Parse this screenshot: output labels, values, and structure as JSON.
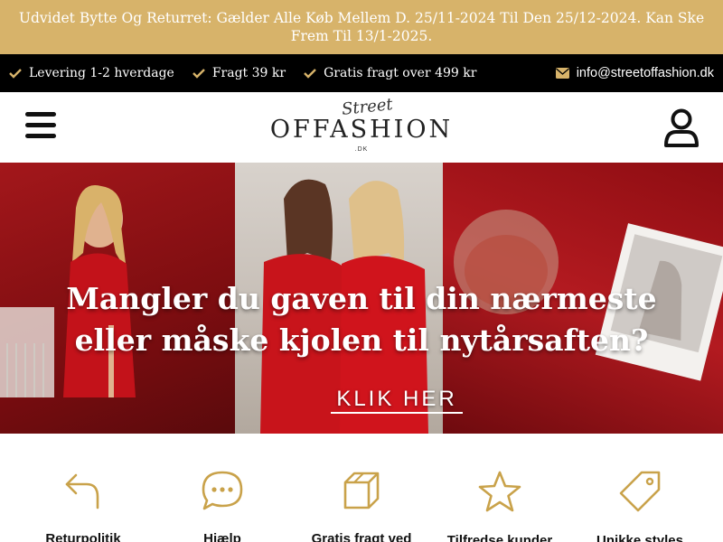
{
  "announcement": {
    "text": "Udvidet Bytte Og Returret: Gælder Alle Køb Mellem D. 25/11-2024 Til Den 25/12-2024. Kan Ske Frem Til 13/1-2025."
  },
  "usp": {
    "items": [
      "Levering 1-2 hverdage",
      "Fragt 39 kr",
      "Gratis fragt over 499 kr"
    ],
    "email": "info@streetoffashion.dk"
  },
  "header": {
    "logo_main": "OFFASHION",
    "logo_script": "Street",
    "logo_suffix": ".DK"
  },
  "hero": {
    "headline_line1": "Mangler du gaven til din nærmeste",
    "headline_line2": "eller måske kjolen til nytårsaften?",
    "cta": "KLIK HER"
  },
  "features": [
    {
      "icon": "return-icon",
      "label": "Returpolitik"
    },
    {
      "icon": "chat-icon",
      "label": "Hjælp"
    },
    {
      "icon": "box-icon",
      "label": "Gratis fragt ved"
    },
    {
      "icon": "star-icon",
      "label": "Tilfredse kunder"
    },
    {
      "icon": "tag-icon",
      "label": "Unikke styles"
    }
  ],
  "colors": {
    "gold": "#d7b36a",
    "black": "#000000",
    "red": "#8b0b0f",
    "icon_gold": "#c9a24a"
  }
}
